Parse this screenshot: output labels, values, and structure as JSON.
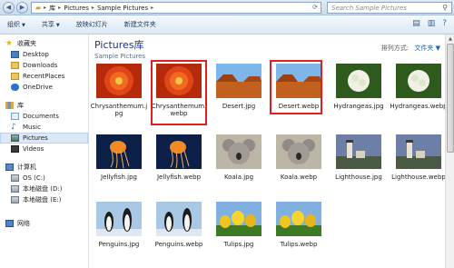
{
  "address": {
    "crumbs": [
      "库",
      "Pictures",
      "Sample Pictures"
    ]
  },
  "search": {
    "placeholder": "Search Sample Pictures"
  },
  "toolbar": {
    "organize": "组织",
    "share": "共享",
    "slideshow": "放映幻灯片",
    "new_folder": "新建文件夹"
  },
  "nav": {
    "favorites": "收藏夹",
    "desktop": "Desktop",
    "downloads": "Downloads",
    "recent": "RecentPlaces",
    "onedrive": "OneDrive",
    "libraries": "库",
    "documents": "Documents",
    "music": "Music",
    "pictures": "Pictures",
    "videos": "Videos",
    "computer": "计算机",
    "os": "OS (C:)",
    "disk_d": "本地磁盘 (D:)",
    "disk_e": "本地磁盘 (E:)",
    "network": "网络"
  },
  "library": {
    "title": "Pictures库",
    "subtitle": "Sample Pictures",
    "arrange_label": "排列方式:",
    "arrange_value": "文件夹"
  },
  "files": [
    {
      "name": "Chrysanthemum.jpg",
      "icon": "chrysanthemum"
    },
    {
      "name": "Chrysanthemum.webp",
      "icon": "chrysanthemum"
    },
    {
      "name": "Desert.jpg",
      "icon": "desert"
    },
    {
      "name": "Desert.webp",
      "icon": "desert"
    },
    {
      "name": "Hydrangeas.jpg",
      "icon": "hydrangeas"
    },
    {
      "name": "Hydrangeas.webp",
      "icon": "hydrangeas"
    },
    {
      "name": "Jellyfish.jpg",
      "icon": "jellyfish"
    },
    {
      "name": "Jellyfish.webp",
      "icon": "jellyfish"
    },
    {
      "name": "Koala.jpg",
      "icon": "koala"
    },
    {
      "name": "Koala.webp",
      "icon": "koala"
    },
    {
      "name": "Lighthouse.jpg",
      "icon": "lighthouse"
    },
    {
      "name": "Lighthouse.webp",
      "icon": "lighthouse"
    },
    {
      "name": "Penguins.jpg",
      "icon": "penguins"
    },
    {
      "name": "Penguins.webp",
      "icon": "penguins"
    },
    {
      "name": "Tulips.jpg",
      "icon": "tulips"
    },
    {
      "name": "Tulips.webp",
      "icon": "tulips"
    }
  ],
  "highlight_color": "#e02020"
}
